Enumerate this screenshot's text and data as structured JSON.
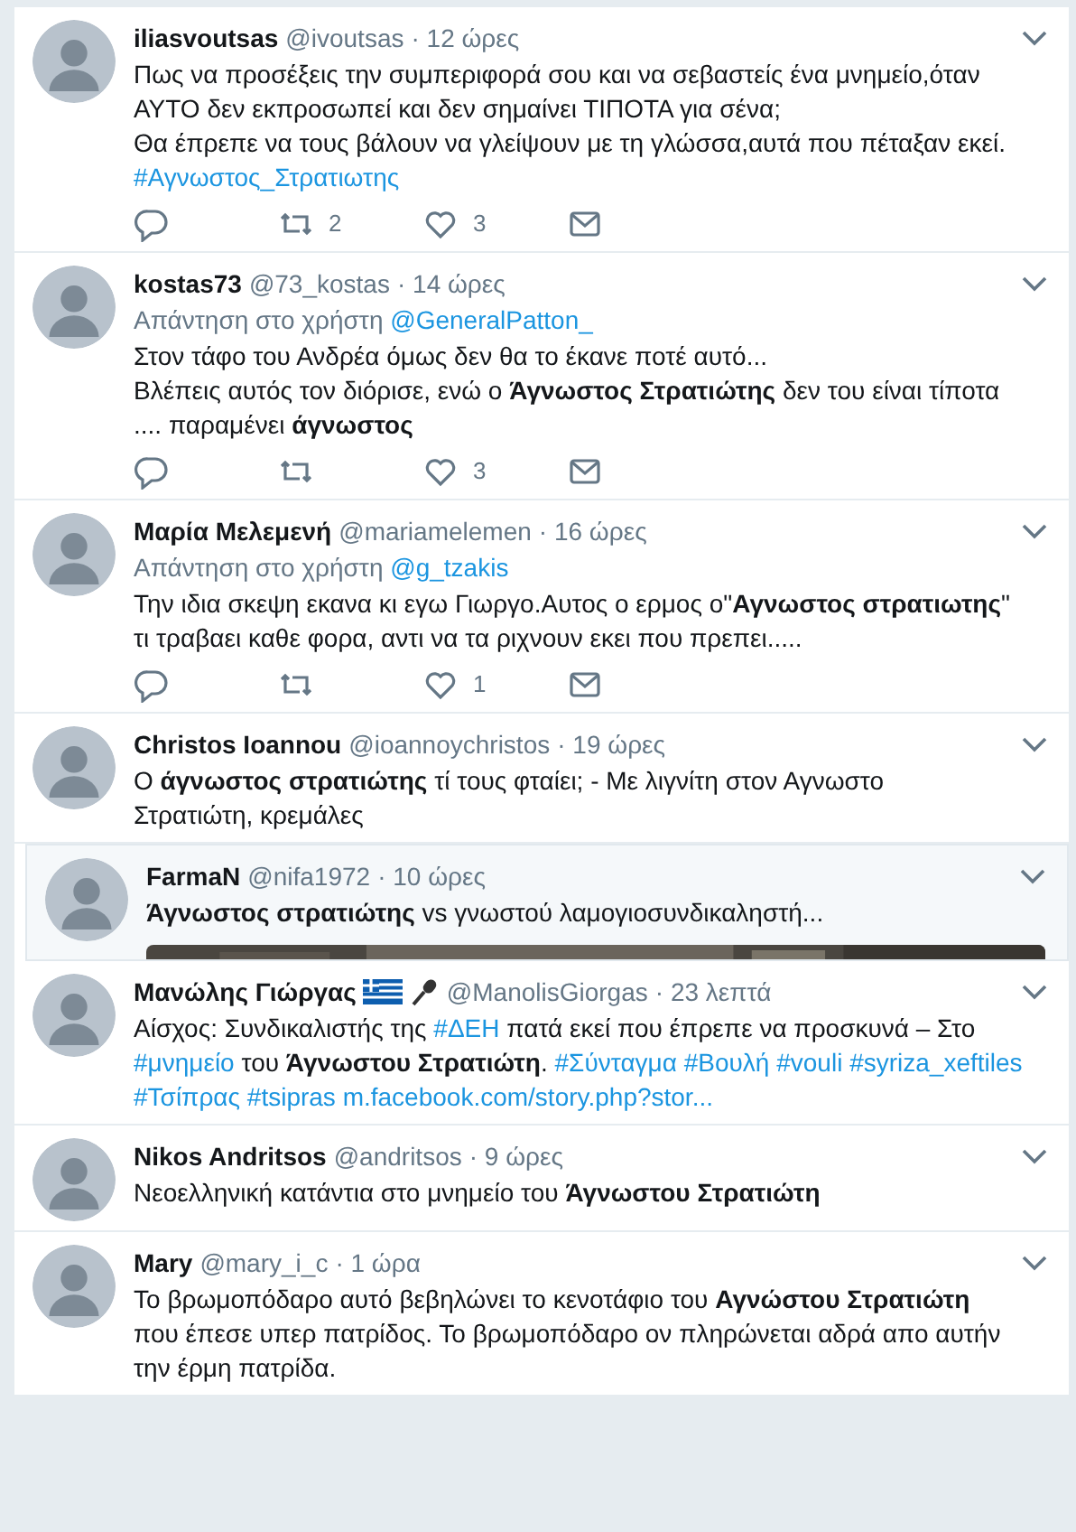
{
  "tweets": [
    {
      "kind": "tweet",
      "name": "iliasvoutsas",
      "handle": "@ivoutsas",
      "time": "· 12 ώρες",
      "lines": [
        [
          {
            "kind": "t",
            "text": "Πως να προσέξεις την συμπεριφορά σου και να σεβαστείς ένα μνημείο,όταν"
          }
        ],
        [
          {
            "kind": "t",
            "text": "ΑΥΤΟ δεν εκπροσωπεί και δεν σημαίνει ΤΙΠΟΤΑ για σένα;"
          }
        ],
        [
          {
            "kind": "t",
            "text": "Θα έπρεπε να τους βάλουν να γλείψουν με τη γλώσσα,αυτά που πέταξαν εκεί."
          }
        ],
        [
          {
            "kind": "tag",
            "text": "#Αγνωστος_Στρατιωτης"
          }
        ]
      ],
      "actions": {
        "retweets": "2",
        "likes": "3"
      }
    },
    {
      "kind": "tweet",
      "name": "kostas73",
      "handle": "@73_kostas",
      "time": "· 14 ώρες",
      "reply_label": "Απάντηση στο χρήστη",
      "reply_to": "@GeneralPatton_",
      "lines": [
        [
          {
            "kind": "t",
            "text": "Στον τάφο του Ανδρέα όμως δεν θα το έκανε ποτέ αυτό..."
          }
        ],
        [
          {
            "kind": "t",
            "text": "Βλέπεις αυτός τον διόρισε, ενώ ο "
          },
          {
            "kind": "b",
            "text": "Άγνωστος Στρατιώτης"
          },
          {
            "kind": "t",
            "text": " δεν του είναι τίποτα"
          }
        ],
        [
          {
            "kind": "t",
            "text": ".... παραμένει "
          },
          {
            "kind": "b",
            "text": "άγνωστος"
          }
        ]
      ],
      "actions": {
        "likes": "3"
      }
    },
    {
      "kind": "tweet",
      "name": "Μαρία Μελεμενή",
      "handle": "@mariamelemen",
      "time": "· 16 ώρες",
      "reply_label": "Απάντηση στο χρήστη",
      "reply_to": "@g_tzakis",
      "lines": [
        [
          {
            "kind": "t",
            "text": "Την ιδια σκεψη εκανα κι εγω Γιωργο.Αυτος ο ερμος ο\""
          },
          {
            "kind": "b",
            "text": "Αγνωστος στρατιωτης"
          },
          {
            "kind": "t",
            "text": "\""
          }
        ],
        [
          {
            "kind": "t",
            "text": "τι τραβαει καθε φορα, αντι να τα ριχνουν εκει που πρεπει....."
          }
        ]
      ],
      "actions": {
        "likes": "1"
      }
    },
    {
      "kind": "tweet",
      "name": "Christos Ioannou",
      "handle": "@ioannoychristos",
      "time": "· 19 ώρες",
      "lines": [
        [
          {
            "kind": "t",
            "text": "Ο "
          },
          {
            "kind": "b",
            "text": "άγνωστος στρατιώτης"
          },
          {
            "kind": "t",
            "text": " τί τους φταίει; - Με λιγνίτη στον Αγνωστο"
          }
        ],
        [
          {
            "kind": "t",
            "text": "Στρατιώτη, κρεμάλες"
          }
        ]
      ]
    },
    {
      "kind": "quoted",
      "name": "FarmaN",
      "handle": "@nifa1972",
      "time": "· 10 ώρες",
      "lines": [
        [
          {
            "kind": "b",
            "text": "Άγνωστος στρατιώτης"
          },
          {
            "kind": "t",
            "text": " vs γνωστού  λαμογιοσυνδικαληστή..."
          }
        ]
      ],
      "media": {
        "kind": "picture"
      }
    },
    {
      "kind": "tweet",
      "name": "Μανώλης Γιώργας",
      "name_icons": [
        {
          "kind": "flag"
        },
        {
          "kind": "microphone"
        }
      ],
      "handle": "@ManolisGiorgas",
      "time": "· 23 λεπτά",
      "lines": [
        [
          {
            "kind": "t",
            "text": "Αίσχος: Συνδικαλιστής της "
          },
          {
            "kind": "tag",
            "text": "#ΔΕΗ"
          },
          {
            "kind": "t",
            "text": " πατά εκεί που έπρεπε να προσκυνά – Στο"
          }
        ],
        [
          {
            "kind": "tag",
            "text": "#μνημείο"
          },
          {
            "kind": "t",
            "text": " του "
          },
          {
            "kind": "b",
            "text": "Άγνωστου Στρατιώτη"
          },
          {
            "kind": "t",
            "text": ". "
          },
          {
            "kind": "tag",
            "text": "#Σύνταγμα"
          },
          {
            "kind": "tag",
            "text": "#Βουλή"
          },
          {
            "kind": "tag",
            "text": "#vouli"
          },
          {
            "kind": "tag",
            "text": "#syriza_xeftiles"
          }
        ],
        [
          {
            "kind": "tag",
            "text": "#Τσίπρας"
          },
          {
            "kind": "tag",
            "text": "#tsipras"
          },
          {
            "kind": "tag",
            "text": "m.facebook.com/story.php?stor..."
          }
        ]
      ]
    },
    {
      "kind": "tweet",
      "name": "Nikos Andritsos",
      "handle": "@andritsos",
      "time": "· 9 ώρες",
      "lines": [
        [
          {
            "kind": "t",
            "text": "Νεοελληνική κατάντια στο μνημείο του "
          },
          {
            "kind": "b",
            "text": "Άγνωστου Στρατιώτη"
          }
        ]
      ]
    },
    {
      "kind": "tweet",
      "name": "Mary",
      "handle": "@mary_i_c",
      "time": "· 1 ώρα",
      "lines": [
        [
          {
            "kind": "t",
            "text": "Το βρωμοπόδαρο αυτό  βεβηλώνει το κενοτάφιο του "
          },
          {
            "kind": "b",
            "text": "Αγνώστου Στρατιώτη"
          }
        ],
        [
          {
            "kind": "t",
            "text": "που έπεσε υπερ πατρίδος. Το βρωμοπόδαρο ον πληρώνεται αδρά απο αυτήν"
          }
        ],
        [
          {
            "kind": "t",
            "text": "την έρμη πατρίδα."
          }
        ]
      ]
    }
  ]
}
